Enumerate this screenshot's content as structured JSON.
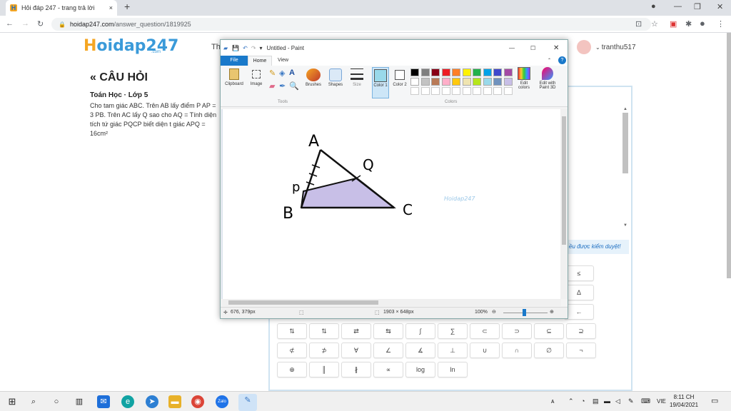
{
  "browser": {
    "tab_title": "Hỏi đáp 247 - trang trả lời",
    "new_tab": "+",
    "close_tab": "×",
    "url_host": "hoidap247.com",
    "url_path": "/answer_question/1819925"
  },
  "site": {
    "logo_main": "oidap247",
    "logo_h": "H",
    "logo_sub": ".com",
    "header_partial": "Th",
    "username": "tranthu517",
    "question_heading": "« CÂU HỎI",
    "subject": "Toán Học · Lớp 5",
    "question_text": "Cho tam giác ABC. Trên AB lấy điểm P AP = 3 PB. Trên AC lấy Q sao cho AQ = Tính diện tích tứ giác PQCP biết diện t giác APQ = 16cm²",
    "moderation": "ều được kiểm duyệt!",
    "panel_arrow": ")"
  },
  "keyboard": {
    "row_right": [
      "≤",
      "Δ",
      "←"
    ],
    "row1": [
      "⇅",
      "⇅",
      "⇄",
      "⇆",
      "∫",
      "∑",
      "⊂",
      "⊃",
      "⊆",
      "⊇"
    ],
    "row2": [
      "⊄",
      "⊅",
      "∀",
      "∠",
      "∡",
      "⊥",
      "∪",
      "∩",
      "∅",
      "¬"
    ],
    "row3": [
      "⊕",
      "║",
      "∦",
      "∝",
      "log",
      "ln"
    ]
  },
  "paint": {
    "title": "Untitled - Paint",
    "tab_file": "File",
    "tab_home": "Home",
    "tab_view": "View",
    "clipboard": "Clipboard",
    "image": "Image",
    "tools": "Tools",
    "brushes": "Brushes",
    "shapes": "Shapes",
    "size": "Size",
    "color1": "Color 1",
    "color2": "Color 2",
    "colors": "Colors",
    "edit_colors": "Edit colors",
    "edit_3d": "Edit with Paint 3D",
    "watermark": "Hoidap247",
    "labels": {
      "A": "A",
      "B": "B",
      "C": "C",
      "P": "p",
      "Q": "Q"
    },
    "cursor_pos": "676, 379px",
    "image_size": "1903 × 648px",
    "zoom": "100%",
    "palette": [
      "#000000",
      "#7f7f7f",
      "#880015",
      "#ed1c24",
      "#ff7f27",
      "#fff200",
      "#22b14c",
      "#00a2e8",
      "#3f48cc",
      "#a349a4",
      "#ffffff",
      "#c3c3c3",
      "#b97a57",
      "#ffaec9",
      "#ffc90e",
      "#efe4b0",
      "#b5e61d",
      "#99d9ea",
      "#7092be",
      "#c8bfe7"
    ],
    "fill_color": "#c8bfe7"
  },
  "taskbar": {
    "time": "8:11 CH",
    "date": "19/04/2021",
    "lang": "VIE"
  }
}
